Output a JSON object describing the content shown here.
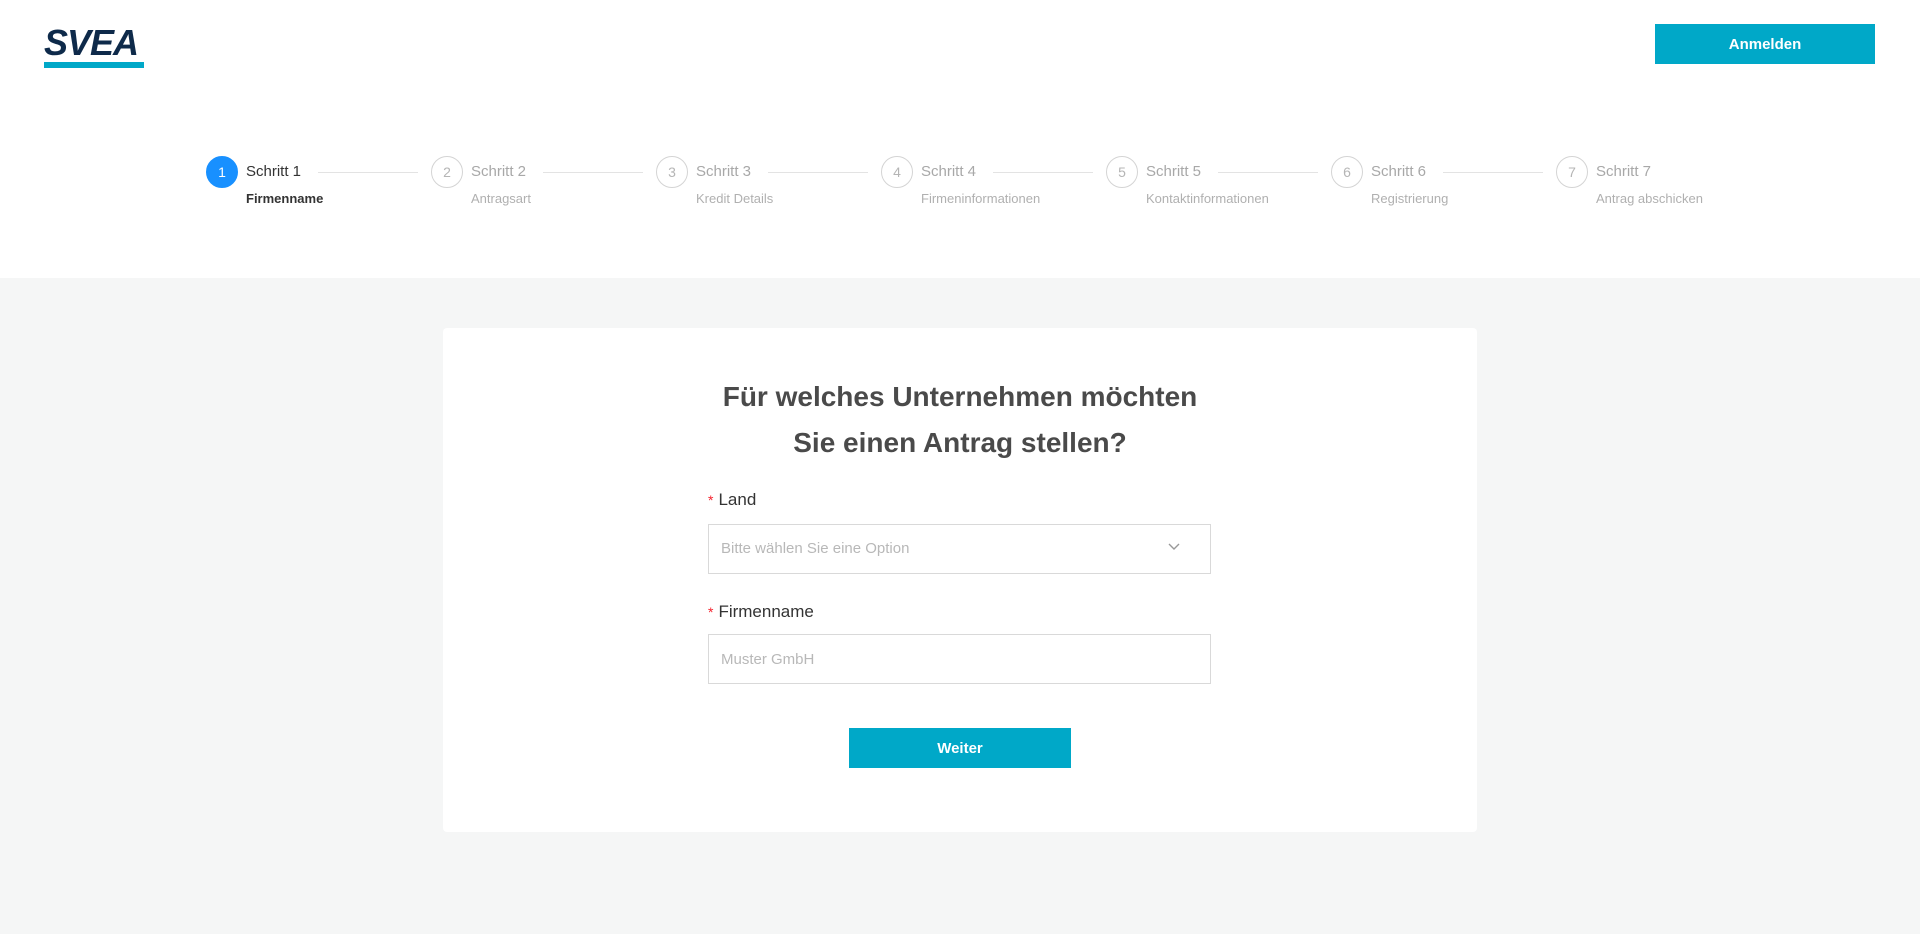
{
  "header": {
    "logo_text": "SVEA",
    "login_label": "Anmelden"
  },
  "steps": [
    {
      "number": "1",
      "title": "Schritt 1",
      "desc": "Firmenname",
      "active": true
    },
    {
      "number": "2",
      "title": "Schritt 2",
      "desc": "Antragsart",
      "active": false
    },
    {
      "number": "3",
      "title": "Schritt 3",
      "desc": "Kredit Details",
      "active": false
    },
    {
      "number": "4",
      "title": "Schritt 4",
      "desc": "Firmeninformationen",
      "active": false
    },
    {
      "number": "5",
      "title": "Schritt 5",
      "desc": "Kontaktinformationen",
      "active": false
    },
    {
      "number": "6",
      "title": "Schritt 6",
      "desc": "Registrierung",
      "active": false
    },
    {
      "number": "7",
      "title": "Schritt 7",
      "desc": "Antrag abschicken",
      "active": false
    }
  ],
  "form": {
    "title_line1": "Für welches Unternehmen möchten",
    "title_line2": "Sie einen Antrag stellen?",
    "required_mark": "*",
    "country_label": "Land",
    "country_placeholder": "Bitte wählen Sie eine Option",
    "company_label": "Firmenname",
    "company_placeholder": "Muster GmbH",
    "company_value": "",
    "next_label": "Weiter"
  },
  "colors": {
    "brand_navy": "#0e2a4a",
    "accent_teal": "#00a8c8",
    "step_active_blue": "#1890ff",
    "required_red": "#f5222d"
  },
  "icons": {
    "select_toggle": "chevron-down-icon"
  }
}
